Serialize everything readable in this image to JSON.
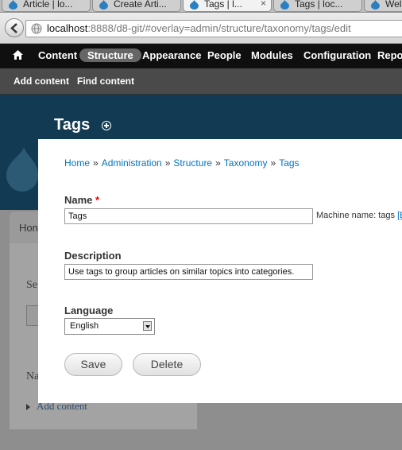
{
  "browser": {
    "tabs": [
      {
        "label": "Article | lo...",
        "active": false
      },
      {
        "label": "Create Arti...",
        "active": false
      },
      {
        "label": "Tags | l...",
        "active": true,
        "close": "×"
      },
      {
        "label": "Tags | loc...",
        "active": false
      },
      {
        "label": "Wel",
        "active": false
      }
    ],
    "url_host": "localhost",
    "url_rest": ":8888/d8-git/#overlay=admin/structure/taxonomy/tags/edit"
  },
  "toolbar": {
    "items": [
      "Content",
      "Structure",
      "Appearance",
      "People",
      "Modules",
      "Configuration",
      "Repor"
    ],
    "active": "Structure"
  },
  "shortcuts": {
    "items": [
      "Add content",
      "Find content"
    ]
  },
  "page": {
    "title": "Tags"
  },
  "background": {
    "tab_label": "Hon",
    "text1": "Se",
    "text2": "Na",
    "link": "Add content"
  },
  "breadcrumb": [
    "Home",
    "Administration",
    "Structure",
    "Taxonomy",
    "Tags"
  ],
  "breadcrumb_separator": "»",
  "form": {
    "name_label": "Name",
    "required_mark": "*",
    "name_value": "Tags",
    "machine_name_prefix": "Machine name: tags",
    "machine_name_link": "[E",
    "description_label": "Description",
    "description_value": "Use tags to group articles on similar topics into categories.",
    "language_label": "Language",
    "language_value": "English",
    "save_label": "Save",
    "delete_label": "Delete"
  },
  "colors": {
    "link": "#0074bd",
    "toolbar_bg": "#0f0f0f",
    "header_band": "#123a52",
    "required": "#ee0000"
  }
}
